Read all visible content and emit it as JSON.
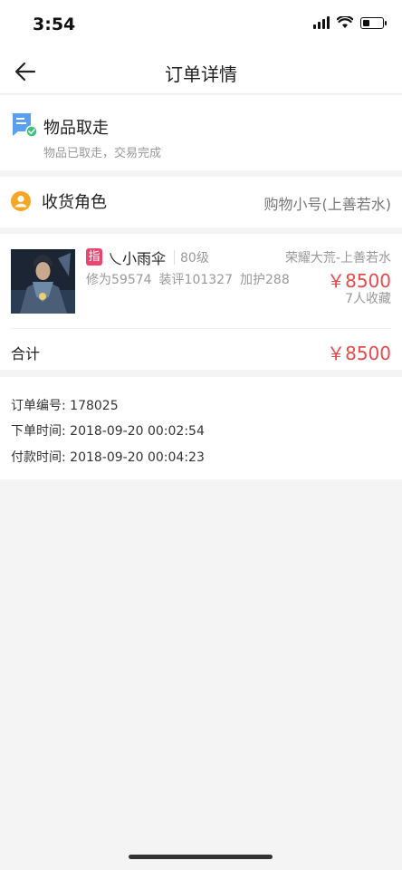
{
  "status_bar": {
    "time": "3:54",
    "battery_level": 0.35
  },
  "nav": {
    "title": "订单详情",
    "back_icon": "arrow-left-icon"
  },
  "order_status": {
    "icon": "order-complete-icon",
    "title": "物品取走",
    "subtitle": "物品已取走，交易完成"
  },
  "receiver": {
    "icon": "user-avatar-icon",
    "label": "收货角色",
    "value": "购物小号(上善若水)"
  },
  "item": {
    "tag": "指",
    "name": "乀小雨伞",
    "level": "80级",
    "server": "荣耀大荒-上善若水",
    "stats": [
      "修为59574",
      "装评101327",
      "加护288"
    ],
    "price": "￥8500",
    "favorites": "7人收藏"
  },
  "total": {
    "label": "合计",
    "value": "￥8500"
  },
  "order_info": {
    "number": "订单编号: 178025",
    "order_time": "下单时间: 2018-09-20 00:02:54",
    "pay_time": "付款时间: 2018-09-20 00:04:23"
  },
  "colors": {
    "price": "#e64a4a",
    "tag": "#e8466f",
    "icon_blue": "#5aa0f0",
    "icon_orange": "#f5a623"
  }
}
